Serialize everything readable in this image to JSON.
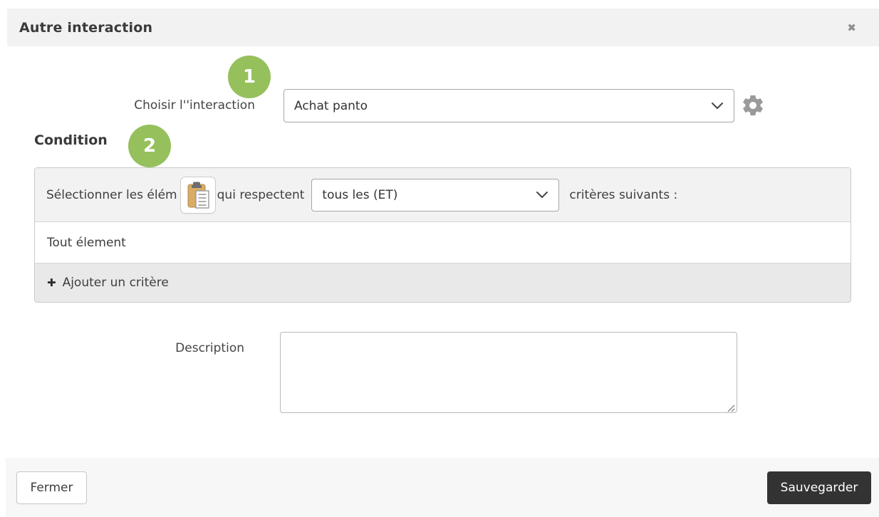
{
  "dialog": {
    "title": "Autre interaction",
    "close_icon": "✖"
  },
  "interaction": {
    "step_badge": "1",
    "label": "Choisir l''interaction",
    "select_value": "Achat panto"
  },
  "condition": {
    "step_badge": "2",
    "heading": "Condition",
    "selector_text_before": "Sélectionner les élém",
    "selector_text_after": "qui respectent",
    "combinator_value": "tous les (ET)",
    "criteria_suffix": "critères suivants :",
    "rows": [
      {
        "label": "Tout élement"
      }
    ],
    "add_criterion_label": "Ajouter un critère",
    "plus_icon": "✚"
  },
  "description": {
    "label": "Description",
    "value": ""
  },
  "footer": {
    "close_label": "Fermer",
    "save_label": "Sauvegarder"
  },
  "colors": {
    "badge_green": "#95c05c",
    "header_bg": "#f2f2f2",
    "save_button_bg": "#333333",
    "gear_gray": "#9a9a9a"
  }
}
